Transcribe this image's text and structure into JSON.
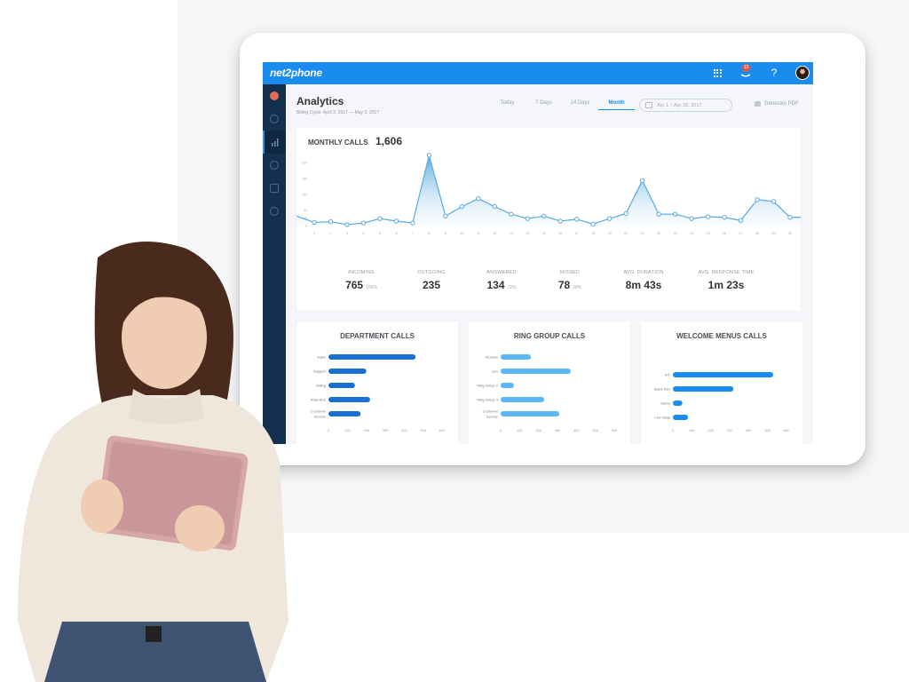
{
  "app": {
    "brand": "net2phone",
    "notification_count": "12",
    "help_label": "?"
  },
  "sidebar": {
    "items": [
      {
        "icon": "user-avatar-icon",
        "active": false
      },
      {
        "icon": "dashboard-gauge-icon",
        "active": false
      },
      {
        "icon": "analytics-bar-chart-icon",
        "active": true
      },
      {
        "icon": "call-history-icon",
        "active": false
      },
      {
        "icon": "phone-icon",
        "active": false
      },
      {
        "icon": "settings-gear-icon",
        "active": false
      }
    ]
  },
  "header": {
    "title": "Analytics",
    "subtitle": "Billing Cycle: April 2, 2017 — May 3, 2017"
  },
  "tabs": [
    {
      "label": "Today",
      "active": false
    },
    {
      "label": "7 Days",
      "active": false
    },
    {
      "label": "14 Days",
      "active": false
    },
    {
      "label": "Month",
      "active": true
    }
  ],
  "date_range": {
    "value": "Apr 1 – Apr 30, 2017"
  },
  "generate_pdf_label": "Generate PDF",
  "monthly": {
    "title": "MONTHLY CALLS",
    "total": "1,606"
  },
  "stats": [
    {
      "label": "INCOMING",
      "value": "765",
      "pct": "100%"
    },
    {
      "label": "OUTGOING",
      "value": "235",
      "pct": ""
    },
    {
      "label": "ANSWERED",
      "value": "134",
      "pct": "72%"
    },
    {
      "label": "MISSED",
      "value": "78",
      "pct": "28%"
    },
    {
      "label": "AVG. DURATION",
      "value": "8m 43s",
      "pct": ""
    },
    {
      "label": "AVG. RESPONSE TIME",
      "value": "1m 23s",
      "pct": ""
    }
  ],
  "chart_data": [
    {
      "type": "area",
      "title": "MONTHLY CALLS",
      "x": [
        1,
        2,
        3,
        4,
        5,
        6,
        7,
        8,
        9,
        10,
        11,
        12,
        13,
        14,
        15,
        16,
        17,
        18,
        19,
        20,
        21,
        22,
        23,
        24,
        25,
        26,
        27,
        28,
        29,
        30
      ],
      "y_ticks": [
        0,
        25,
        50,
        100,
        150,
        200
      ],
      "ylim": [
        0,
        230
      ],
      "start_value": 30,
      "values": [
        10,
        12,
        3,
        8,
        22,
        14,
        8,
        222,
        30,
        60,
        85,
        60,
        36,
        22,
        30,
        14,
        20,
        5,
        22,
        38,
        142,
        36,
        36,
        22,
        28,
        26,
        16,
        82,
        76,
        26
      ],
      "end_value": 26,
      "color": "#5aa9e0"
    },
    {
      "type": "bar",
      "title": "DEPARTMENT CALLS",
      "orientation": "horizontal",
      "categories": [
        "Sales",
        "Support",
        "Billing",
        "Retention",
        "Customer Service"
      ],
      "values": [
        460,
        200,
        140,
        220,
        170
      ],
      "x_ticks": [
        0,
        100,
        200,
        300,
        400,
        500,
        600
      ],
      "xlim": [
        0,
        600
      ],
      "color": "#1a6fd1"
    },
    {
      "type": "bar",
      "title": "RING GROUP CALLS",
      "orientation": "horizontal",
      "categories": [
        "Stooeys",
        "Zen",
        "Ring Group 2",
        "Ring Group 3",
        "Customer Service"
      ],
      "values": [
        160,
        370,
        70,
        230,
        310
      ],
      "x_ticks": [
        0,
        100,
        200,
        300,
        400,
        500,
        600
      ],
      "xlim": [
        0,
        600
      ],
      "color": "#5bb8f5"
    },
    {
      "type": "bar",
      "title": "WELCOME MENUS CALLS",
      "orientation": "horizontal",
      "categories": [
        "IVT",
        "Basic Rev",
        "Game",
        "Live Ninja"
      ],
      "values": [
        530,
        320,
        50,
        80
      ],
      "x_ticks": [
        0,
        100,
        200,
        300,
        400,
        500,
        600
      ],
      "xlim": [
        0,
        600
      ],
      "color": "#1a8cf0"
    }
  ]
}
